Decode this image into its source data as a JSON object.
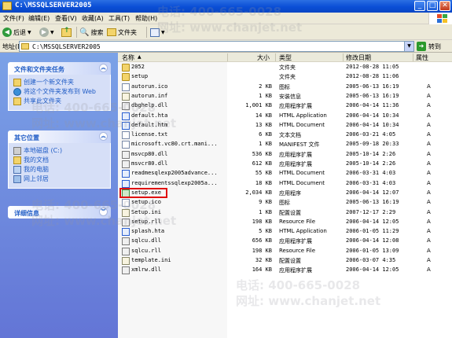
{
  "window": {
    "title": "C:\\MSSQLSERVER2005"
  },
  "menu": [
    "文件(F)",
    "编辑(E)",
    "查看(V)",
    "收藏(A)",
    "工具(T)",
    "帮助(H)"
  ],
  "toolbar": {
    "back": "后退",
    "search": "搜索",
    "folders": "文件夹"
  },
  "address": {
    "label": "地址(D)",
    "value": "C:\\MSSQLSERVER2005",
    "go": "转到"
  },
  "tasks": {
    "file_folder": {
      "title": "文件和文件夹任务",
      "items": [
        "创建一个新文件夹",
        "将这个文件夹发布到 Web",
        "共享此文件夹"
      ]
    },
    "other": {
      "title": "其它位置",
      "items": [
        "本地磁盘 (C:)",
        "我的文档",
        "我的电脑",
        "网上邻居"
      ]
    },
    "details": {
      "title": "详细信息"
    }
  },
  "columns": {
    "name": "名称",
    "size": "大小",
    "type": "类型",
    "modified": "修改日期",
    "attr": "属性"
  },
  "files": [
    {
      "name": "2052",
      "size": "",
      "type": "文件夹",
      "date": "2012-08-28 11:05",
      "attr": "",
      "icon": "folder-icon"
    },
    {
      "name": "setup",
      "size": "",
      "type": "文件夹",
      "date": "2012-08-28 11:06",
      "attr": "",
      "icon": "folder-icon"
    },
    {
      "name": "autorun.ico",
      "size": "2 KB",
      "type": "图标",
      "date": "2005-06-13 16:19",
      "attr": "A",
      "icon": "image-icon"
    },
    {
      "name": "autorun.inf",
      "size": "1 KB",
      "type": "安装信息",
      "date": "2005-06-13 16:19",
      "attr": "A",
      "icon": "settings-file-icon"
    },
    {
      "name": "dbghelp.dll",
      "size": "1,001 KB",
      "type": "应用程序扩展",
      "date": "2006-04-14 11:36",
      "attr": "A",
      "icon": "dll-icon"
    },
    {
      "name": "default.hta",
      "size": "14 KB",
      "type": "HTML Application",
      "date": "2006-04-14 10:34",
      "attr": "A",
      "icon": "html-icon"
    },
    {
      "name": "default.htm",
      "size": "13 KB",
      "type": "HTML Document",
      "date": "2006-04-14 10:34",
      "attr": "A",
      "icon": "html-icon"
    },
    {
      "name": "license.txt",
      "size": "6 KB",
      "type": "文本文档",
      "date": "2006-03-21 4:05",
      "attr": "A",
      "icon": "text-file-icon"
    },
    {
      "name": "microsoft.vc80.crt.mani...",
      "size": "1 KB",
      "type": "MANIFEST 文件",
      "date": "2005-09-18 20:33",
      "attr": "A",
      "icon": "file-icon"
    },
    {
      "name": "msvcp80.dll",
      "size": "536 KB",
      "type": "应用程序扩展",
      "date": "2005-10-14 2:26",
      "attr": "A",
      "icon": "dll-icon"
    },
    {
      "name": "msvcr80.dll",
      "size": "612 KB",
      "type": "应用程序扩展",
      "date": "2005-10-14 2:26",
      "attr": "A",
      "icon": "dll-icon"
    },
    {
      "name": "readmesqlexp2005advance...",
      "size": "55 KB",
      "type": "HTML Document",
      "date": "2006-03-31 4:03",
      "attr": "A",
      "icon": "html-icon"
    },
    {
      "name": "requirementssqlexp2005a...",
      "size": "18 KB",
      "type": "HTML Document",
      "date": "2006-03-31 4:03",
      "attr": "A",
      "icon": "html-icon"
    },
    {
      "name": "setup.exe",
      "size": "2,034 KB",
      "type": "应用程序",
      "date": "2006-04-14 12:07",
      "attr": "A",
      "icon": "exe-icon"
    },
    {
      "name": "setup.ico",
      "size": "9 KB",
      "type": "图标",
      "date": "2005-06-13 16:19",
      "attr": "A",
      "icon": "image-icon"
    },
    {
      "name": "Setup.ini",
      "size": "1 KB",
      "type": "配置设置",
      "date": "2007-12-17 2:29",
      "attr": "A",
      "icon": "settings-file-icon"
    },
    {
      "name": "setup.rll",
      "size": "198 KB",
      "type": "Resource File",
      "date": "2006-04-14 12:05",
      "attr": "A",
      "icon": "resource-file-icon"
    },
    {
      "name": "splash.hta",
      "size": "5 KB",
      "type": "HTML Application",
      "date": "2006-01-05 11:29",
      "attr": "A",
      "icon": "html-icon"
    },
    {
      "name": "sqlcu.dll",
      "size": "656 KB",
      "type": "应用程序扩展",
      "date": "2006-04-14 12:08",
      "attr": "A",
      "icon": "dll-icon"
    },
    {
      "name": "sqlcu.rll",
      "size": "198 KB",
      "type": "Resource File",
      "date": "2006-01-05 13:09",
      "attr": "A",
      "icon": "resource-file-icon"
    },
    {
      "name": "template.ini",
      "size": "32 KB",
      "type": "配置设置",
      "date": "2006-03-07 4:35",
      "attr": "A",
      "icon": "settings-file-icon"
    },
    {
      "name": "xmlrw.dll",
      "size": "164 KB",
      "type": "应用程序扩展",
      "date": "2006-04-14 12:05",
      "attr": "A",
      "icon": "dll-icon"
    }
  ],
  "highlight_file": "setup.exe",
  "watermark": {
    "phone": "电话: 400-665-0028",
    "site": "网址: www.chanjet.net"
  }
}
